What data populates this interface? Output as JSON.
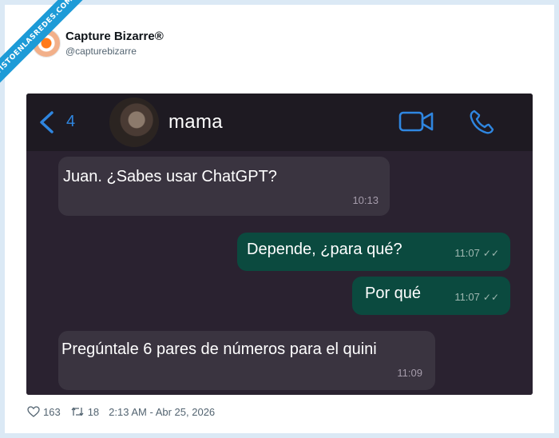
{
  "watermark": "VISTOENLASREDES.COM",
  "author": {
    "name": "Capture Bizarre®",
    "handle": "@capturebizarre"
  },
  "chat": {
    "back_count": "4",
    "contact_name": "mama",
    "messages": [
      {
        "direction": "in",
        "text": "Juan. ¿Sabes usar ChatGPT?",
        "time": "10:13"
      },
      {
        "direction": "out",
        "text": "Depende, ¿para qué?",
        "time": "11:07"
      },
      {
        "direction": "out",
        "text": "Por qué",
        "time": "11:07"
      },
      {
        "direction": "in",
        "text": "Pregúntale 6 pares de números para el quini",
        "time": "11:09"
      }
    ]
  },
  "stats": {
    "likes": "163",
    "retweets": "18",
    "timestamp": "2:13 AM - Abr 25, 2026"
  },
  "colors": {
    "header_bg": "#1e1a22",
    "chat_bg": "#2a2230",
    "incoming_bubble": "#3a3440",
    "outgoing_bubble": "#0b4a3f",
    "ios_blue": "#2f86e0"
  }
}
